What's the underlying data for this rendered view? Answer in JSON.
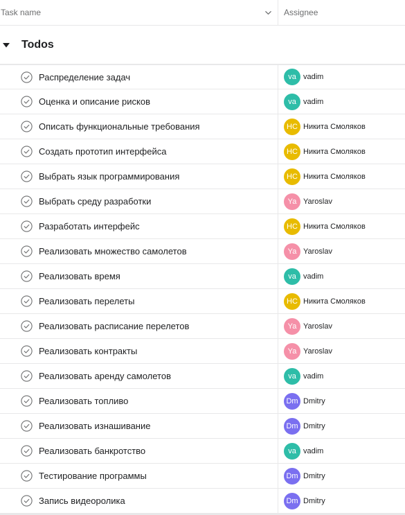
{
  "header": {
    "task_name_label": "Task name",
    "assignee_label": "Assignee",
    "sort_icon": "chevron-down-icon"
  },
  "section": {
    "title": "Todos",
    "toggle_icon": "triangle-down-icon"
  },
  "avatar_colors": {
    "vadim": "#2ebda8",
    "nikita": "#e8bb00",
    "yaroslav": "#f590a8",
    "dmitry": "#7a6ff0"
  },
  "tasks": [
    {
      "name": "Распределение задач",
      "assignee": "vadim",
      "initials": "va",
      "color_key": "vadim"
    },
    {
      "name": "Оценка и описание рисков",
      "assignee": "vadim",
      "initials": "va",
      "color_key": "vadim"
    },
    {
      "name": "Описать функциональные требования",
      "assignee": "Никита Смоляков",
      "initials": "НС",
      "color_key": "nikita"
    },
    {
      "name": "Создать прототип интерфейса",
      "assignee": "Никита Смоляков",
      "initials": "НС",
      "color_key": "nikita"
    },
    {
      "name": "Выбрать язык программирования",
      "assignee": "Никита Смоляков",
      "initials": "НС",
      "color_key": "nikita"
    },
    {
      "name": "Выбрать среду разработки",
      "assignee": "Yaroslav",
      "initials": "Ya",
      "color_key": "yaroslav"
    },
    {
      "name": "Разработать интерфейс",
      "assignee": "Никита Смоляков",
      "initials": "НС",
      "color_key": "nikita"
    },
    {
      "name": "Реализовать множество самолетов",
      "assignee": "Yaroslav",
      "initials": "Ya",
      "color_key": "yaroslav"
    },
    {
      "name": "Реализовать время",
      "assignee": "vadim",
      "initials": "va",
      "color_key": "vadim"
    },
    {
      "name": "Реализовать перелеты",
      "assignee": "Никита Смоляков",
      "initials": "НС",
      "color_key": "nikita"
    },
    {
      "name": "Реализовать расписание перелетов",
      "assignee": "Yaroslav",
      "initials": "Ya",
      "color_key": "yaroslav"
    },
    {
      "name": "Реализовать контракты",
      "assignee": "Yaroslav",
      "initials": "Ya",
      "color_key": "yaroslav"
    },
    {
      "name": "Реализовать аренду самолетов",
      "assignee": "vadim",
      "initials": "va",
      "color_key": "vadim"
    },
    {
      "name": "Реализовать топливо",
      "assignee": "Dmitry",
      "initials": "Dm",
      "color_key": "dmitry"
    },
    {
      "name": "Реализовать изнашивание",
      "assignee": "Dmitry",
      "initials": "Dm",
      "color_key": "dmitry"
    },
    {
      "name": "Реализовать банкротство",
      "assignee": "vadim",
      "initials": "va",
      "color_key": "vadim"
    },
    {
      "name": "Тестирование программы",
      "assignee": "Dmitry",
      "initials": "Dm",
      "color_key": "dmitry"
    },
    {
      "name": "Запись видеоролика",
      "assignee": "Dmitry",
      "initials": "Dm",
      "color_key": "dmitry"
    }
  ]
}
